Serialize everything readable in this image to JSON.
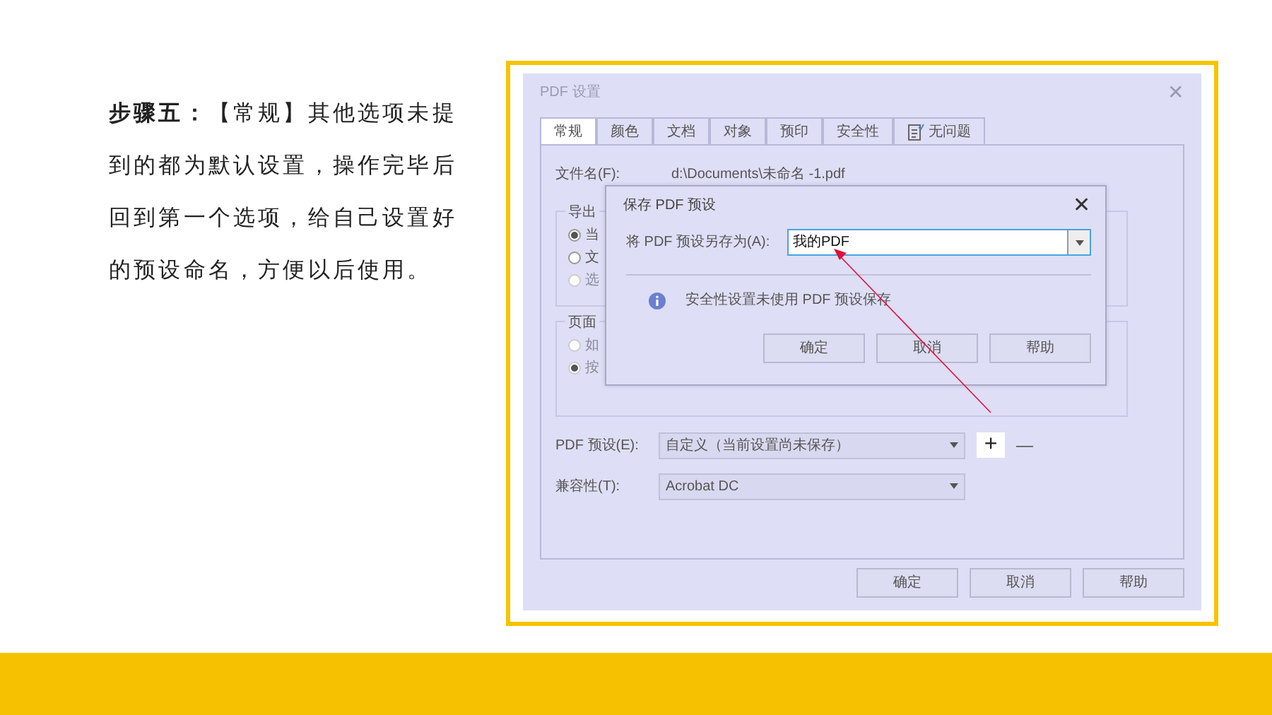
{
  "instruction": "**步骤五：**【常规】其他选项未提到的都为默认设置，操作完毕后回到第一个选项，给自己设置好的预设命名，方便以后使用。",
  "settings_dialog": {
    "title": "PDF 设置",
    "close": "✕",
    "tabs": [
      {
        "label": "常规",
        "selected": true,
        "kind": "text"
      },
      {
        "label": "颜色",
        "selected": false,
        "kind": "text"
      },
      {
        "label": "文档",
        "selected": false,
        "kind": "text"
      },
      {
        "label": "对象",
        "selected": false,
        "kind": "text"
      },
      {
        "label": "预印",
        "selected": false,
        "kind": "text"
      },
      {
        "label": "安全性",
        "selected": false,
        "kind": "text"
      },
      {
        "label": "无问题",
        "selected": false,
        "kind": "icon"
      }
    ],
    "file_label": "文件名(F):",
    "file_value": "d:\\Documents\\未命名 -1.pdf",
    "groups": [
      {
        "title": "导出",
        "options": [
          {
            "label": "当",
            "selected": true,
            "disabled": false
          },
          {
            "label": "文",
            "selected": false,
            "disabled": false
          },
          {
            "label": "选",
            "selected": false,
            "disabled": true
          }
        ]
      },
      {
        "title": "页面",
        "options": [
          {
            "label": "如",
            "selected": false,
            "disabled": true
          },
          {
            "label": "按",
            "selected": true,
            "disabled": true
          }
        ]
      }
    ],
    "preset": {
      "label": "PDF 预设(E):",
      "value": "自定义（当前设置尚未保存）",
      "add": "+",
      "remove": "—"
    },
    "compatibility": {
      "label": "兼容性(T):",
      "value": "Acrobat DC"
    },
    "buttons": [
      "确定",
      "取消",
      "帮助"
    ]
  },
  "save_dialog": {
    "title": "保存 PDF 预设",
    "close": "✕",
    "label": "将 PDF 预设另存为(A):",
    "value": "我的PDF",
    "message": "安全性设置未使用 PDF 预设保存",
    "buttons": [
      "确定",
      "取消",
      "帮助"
    ]
  }
}
